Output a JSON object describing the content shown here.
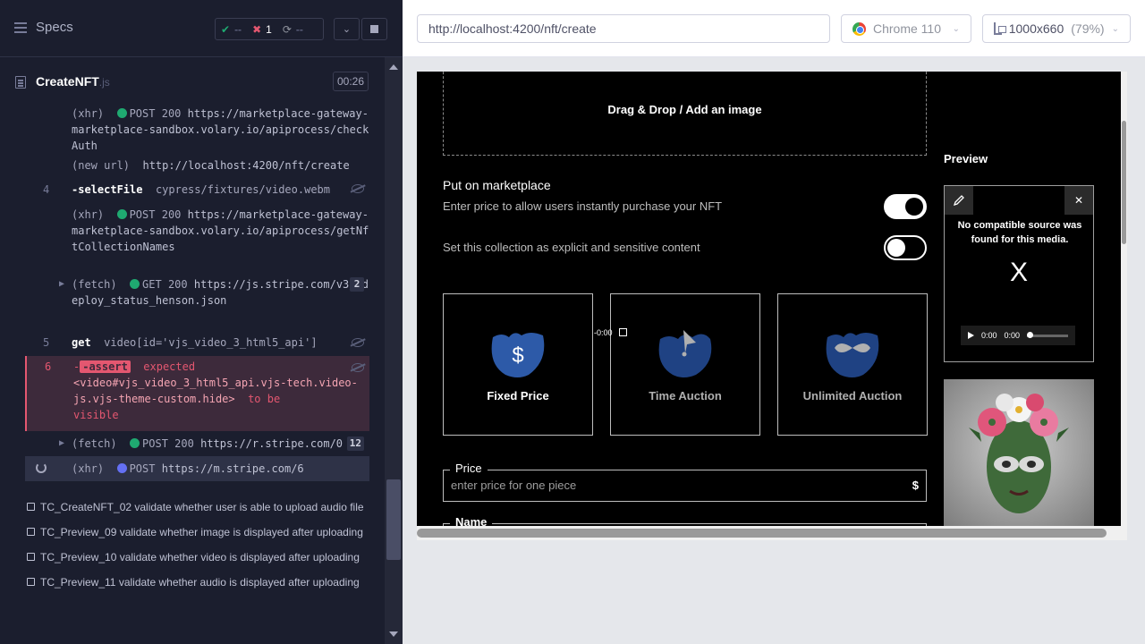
{
  "runner": {
    "specs_label": "Specs",
    "stats": {
      "passed": "--",
      "failed": "1",
      "pending": "--"
    },
    "spec_file": {
      "name": "CreateNFT",
      "ext": ".js",
      "duration": "00:26"
    },
    "commands": [
      {
        "kind": "(xhr)",
        "method": "POST",
        "status": "200",
        "url": "https://marketplace-gateway-marketplace-sandbox.volary.io/apiprocess/checkAuth"
      },
      {
        "kind": "(new url)",
        "url": "http://localhost:4200/nft/create"
      },
      {
        "num": "4",
        "name": "-selectFile",
        "arg": "cypress/fixtures/video.webm"
      },
      {
        "kind": "(xhr)",
        "method": "POST",
        "status": "200",
        "url": "https://marketplace-gateway-marketplace-sandbox.volary.io/apiprocess/getNftCollectionNames"
      },
      {
        "kind": "(fetch)",
        "method": "GET",
        "status": "200",
        "url": "https://js.stripe.com/v3/.deploy_status_henson.json",
        "count": "2"
      },
      {
        "num": "5",
        "name": "get",
        "arg": "video[id='vjs_video_3_html5_api']"
      },
      {
        "num": "6",
        "name": "-assert",
        "text1": "expected",
        "text2": "<video#vjs_video_3_html5_api.vjs-tech.video-js.vjs-theme-custom.hide>",
        "text3": "to be",
        "text4": "visible"
      },
      {
        "kind": "(fetch)",
        "method": "POST",
        "status": "200",
        "url": "https://r.stripe.com/0",
        "count": "12"
      },
      {
        "kind": "(xhr)",
        "method": "POST",
        "url": "https://m.stripe.com/6"
      }
    ],
    "tests": [
      "TC_CreateNFT_02 validate whether user is able to upload audio file",
      "TC_Preview_09 validate whether image is displayed after uploading",
      "TC_Preview_10 validate whether video is displayed after uploading",
      "TC_Preview_11 validate whether audio is displayed after uploading"
    ]
  },
  "browser": {
    "url": "http://localhost:4200/nft/create",
    "browser_name": "Chrome 110",
    "viewport": "1000x660",
    "zoom": "(79%)"
  },
  "app": {
    "dropzone_label": "Drag & Drop / Add an image",
    "marketplace_title": "Put on marketplace",
    "marketplace_sub": "Enter price to allow users instantly purchase your NFT",
    "marketplace_toggle": true,
    "explicit_label": "Set this collection as explicit and sensitive content",
    "explicit_toggle": false,
    "pricing_options": [
      "Fixed Price",
      "Time Auction",
      "Unlimited Auction"
    ],
    "price_label": "Price",
    "price_placeholder": "enter price for one piece",
    "price_currency": "$",
    "name_label": "Name",
    "preview_title": "Preview",
    "video_error": "No compatible source was found for this media.",
    "video_error_x": "X",
    "video_time_current": "0:00",
    "video_time_duration": "0:00",
    "video_time_remaining": "-0:00"
  },
  "colors": {
    "accent_blue": "#2d5aa8",
    "fail_red": "#e45770",
    "pass_green": "#1fa971"
  }
}
